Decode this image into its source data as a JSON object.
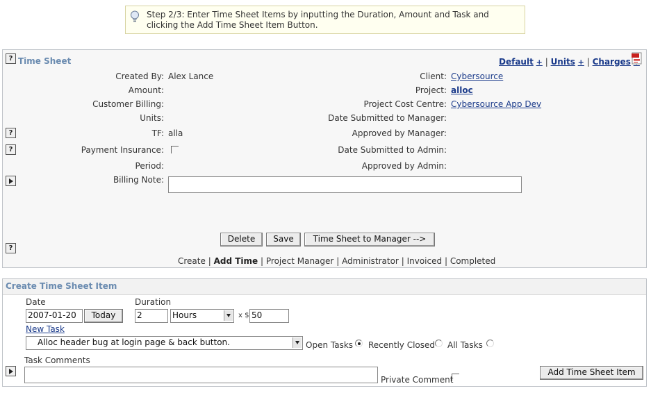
{
  "tip": {
    "text": "Step 2/3: Enter Time Sheet Items by inputting the Duration, Amount and Task and clicking the Add Time Sheet Item Button."
  },
  "timesheet": {
    "title": "Time Sheet",
    "header_links": {
      "default": "Default",
      "units": "Units",
      "charges": "Charges",
      "plus": "+",
      "sep": "|"
    },
    "created_by_label": "Created By:",
    "created_by_value": "Alex Lance",
    "amount_label": "Amount:",
    "customer_billing_label": "Customer Billing:",
    "units_label": "Units:",
    "tf_label": "TF:",
    "tf_value": "alla",
    "payment_insurance_label": "Payment Insurance:",
    "period_label": "Period:",
    "billing_note_label": "Billing Note:",
    "client_label": "Client:",
    "client_value": "Cybersource",
    "project_label": "Project:",
    "project_value": "alloc",
    "project_cost_centre_label": "Project Cost Centre:",
    "project_cost_centre_value": "Cybersource App Dev",
    "date_submitted_manager_label": "Date Submitted to Manager:",
    "approved_manager_label": "Approved by Manager:",
    "date_submitted_admin_label": "Date Submitted to Admin:",
    "approved_admin_label": "Approved by Admin:",
    "buttons": {
      "delete": "Delete",
      "save": "Save",
      "to_manager": "Time Sheet to Manager -->"
    },
    "steps": [
      "Create",
      "Add Time",
      "Project Manager",
      "Administrator",
      "Invoiced",
      "Completed"
    ],
    "step_sep": "|",
    "current_step": "Add Time"
  },
  "create_item": {
    "title": "Create Time Sheet Item",
    "date_label": "Date",
    "date_value": "2007-01-20",
    "today_button": "Today",
    "duration_label": "Duration",
    "duration_value": "2",
    "unit_selected": "Hours",
    "rate_prefix": "x $",
    "rate_value": "50",
    "new_task_link": "New Task",
    "task_selected": "Alloc header bug at login page & back button.",
    "open_tasks_label": "Open Tasks",
    "recently_closed_label": "Recently Closed",
    "all_tasks_label": "All Tasks",
    "task_comments_label": "Task Comments",
    "private_comment_label": "Private Comment",
    "add_button": "Add Time Sheet Item"
  },
  "help_icon_glyph": "?",
  "colors": {
    "panel_title": "#6a8bb0",
    "link": "#1a3a8a",
    "tip_bg": "#fffff0"
  }
}
